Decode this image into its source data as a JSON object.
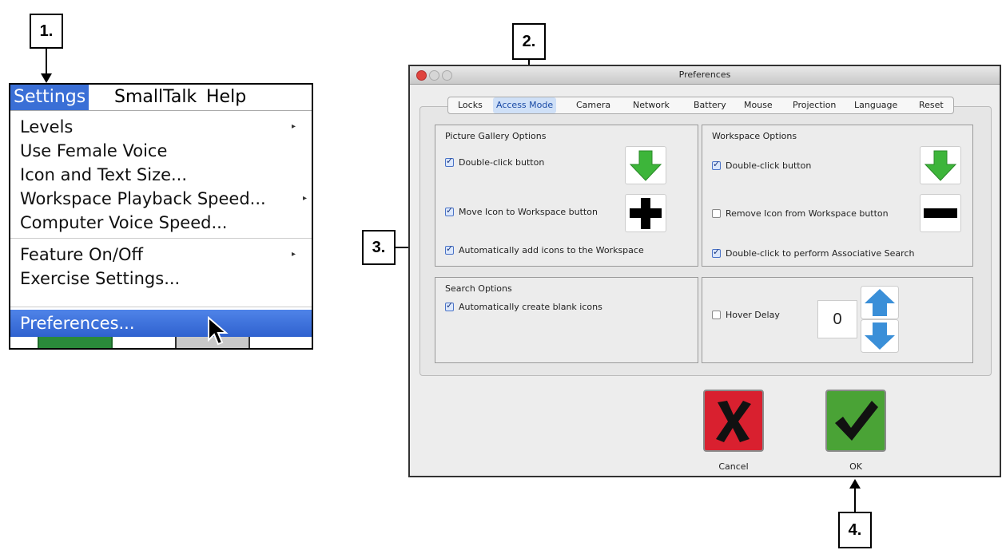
{
  "steps": {
    "s1": "1.",
    "s2": "2.",
    "s3": "3.",
    "s4": "4."
  },
  "menu": {
    "menubar": [
      "Settings",
      "SmallTalk",
      "Help"
    ],
    "items": [
      {
        "label": "Levels",
        "submenu": true
      },
      {
        "label": "Use Female Voice",
        "submenu": false
      },
      {
        "label": "Icon and Text Size...",
        "submenu": false
      },
      {
        "label": "Workspace Playback Speed...",
        "submenu": true
      },
      {
        "label": "Computer Voice Speed...",
        "submenu": false
      },
      {
        "label": "Feature On/Off",
        "submenu": true
      },
      {
        "label": "Exercise Settings...",
        "submenu": false
      },
      {
        "label": "Preferences...",
        "submenu": false,
        "highlighted": true
      }
    ]
  },
  "window": {
    "title": "Preferences",
    "tabs": [
      "Locks",
      "Access Mode",
      "Camera",
      "Network",
      "Battery",
      "Mouse",
      "Projection",
      "Language",
      "Reset"
    ],
    "active_tab": "Access Mode",
    "picture_gallery": {
      "title": "Picture Gallery Options",
      "options": [
        {
          "label": "Double-click button",
          "checked": true,
          "icon": "green-down-arrow-icon"
        },
        {
          "label": "Move Icon to Workspace button",
          "checked": true,
          "icon": "black-plus-icon"
        },
        {
          "label": "Automatically add icons to the Workspace",
          "checked": true
        }
      ]
    },
    "workspace": {
      "title": "Workspace Options",
      "options": [
        {
          "label": "Double-click button",
          "checked": true,
          "icon": "green-down-arrow-icon"
        },
        {
          "label": "Remove Icon from Workspace button",
          "checked": false,
          "icon": "black-minus-icon"
        },
        {
          "label": "Double-click to perform Associative Search",
          "checked": true
        }
      ]
    },
    "search": {
      "title": "Search Options",
      "options": [
        {
          "label": "Automatically create blank icons",
          "checked": true
        }
      ]
    },
    "hover": {
      "label": "Hover Delay",
      "checked": false,
      "value": "0"
    },
    "buttons": {
      "cancel": "Cancel",
      "ok": "OK"
    }
  },
  "colors": {
    "menu_highlight": "#3a6fd6",
    "cancel": "#d9202f",
    "ok": "#4aa336",
    "arrow_blue": "#3a8fd8",
    "arrow_green": "#3db53a"
  }
}
